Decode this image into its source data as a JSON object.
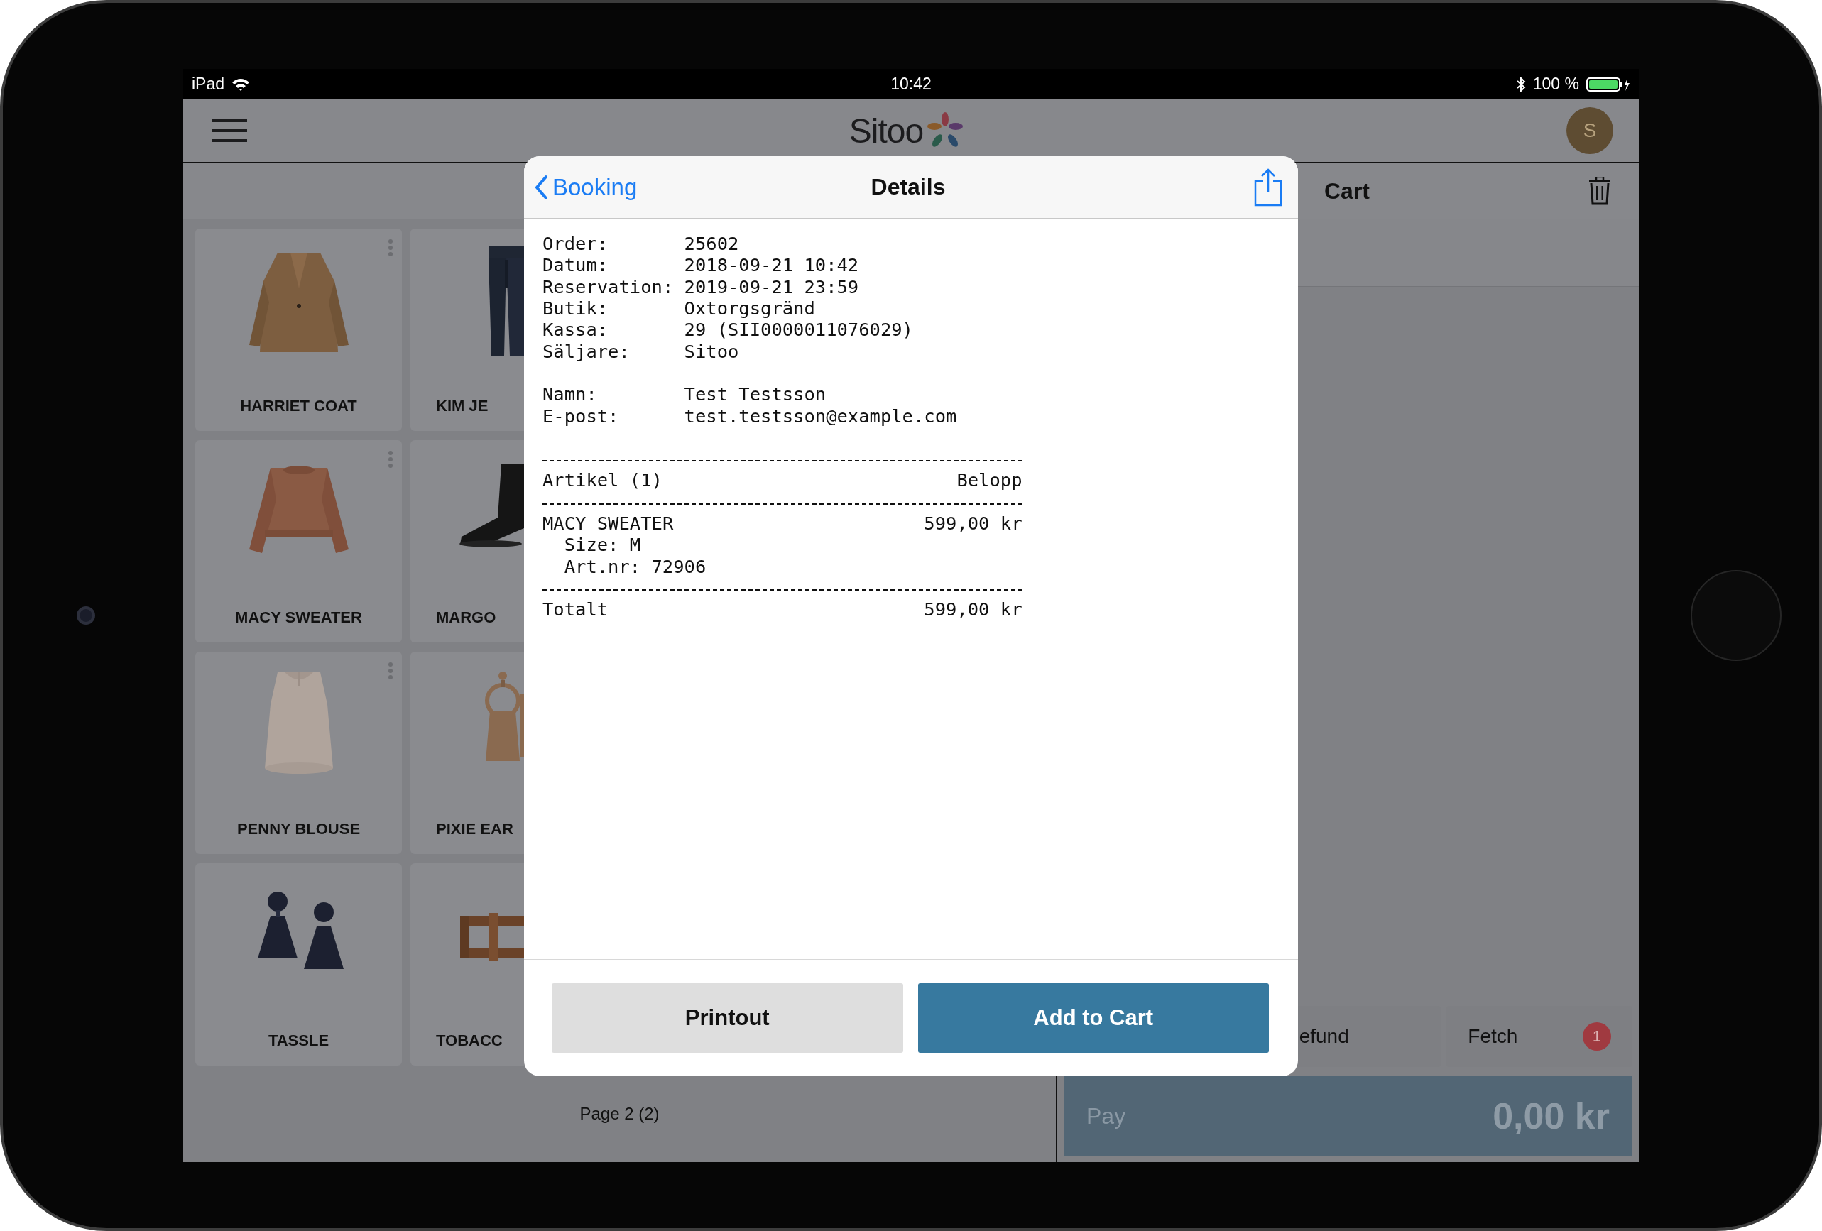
{
  "status_bar": {
    "device": "iPad",
    "time": "10:42",
    "battery": "100 %"
  },
  "header": {
    "logo": "Sitoo",
    "avatar": "S"
  },
  "products": [
    {
      "name": "HARRIET COAT",
      "menu": true
    },
    {
      "name": "KIM JE",
      "menu": false
    },
    {
      "name": "MACY SWEATER",
      "menu": true
    },
    {
      "name": "MARGO",
      "menu": false
    },
    {
      "name": "PENNY BLOUSE",
      "menu": true
    },
    {
      "name": "PIXIE EAR",
      "menu": false
    },
    {
      "name": "TASSLE",
      "menu": false
    },
    {
      "name": "TOBACC",
      "menu": false
    }
  ],
  "pager": "Page 2 (2)",
  "cart": {
    "title": "Cart",
    "buttons": [
      {
        "label": "efund",
        "kind": "plain"
      },
      {
        "label": "Fetch",
        "kind": "badge",
        "badge": "1"
      }
    ],
    "pay": {
      "label": "Pay",
      "amount": "0,00 kr"
    }
  },
  "dialog": {
    "back": "Booking",
    "title": "Details",
    "receipt": [
      {
        "kind": "field",
        "label": "Order:",
        "value": "25602"
      },
      {
        "kind": "field",
        "label": "Datum:",
        "value": "2018-09-21 10:42"
      },
      {
        "kind": "field",
        "label": "Reservation:",
        "value": "2019-09-21 23:59"
      },
      {
        "kind": "field",
        "label": "Butik:",
        "value": "Oxtorgsgränd"
      },
      {
        "kind": "field",
        "label": "Kassa:",
        "value": "29 (SII0000011076029)"
      },
      {
        "kind": "field",
        "label": "Säljare:",
        "value": "Sitoo"
      },
      {
        "kind": "blank"
      },
      {
        "kind": "field",
        "label": "Namn:",
        "value": "Test Testsson"
      },
      {
        "kind": "field",
        "label": "E-post:",
        "value": "test.testsson@example.com"
      },
      {
        "kind": "blank"
      },
      {
        "kind": "rule"
      },
      {
        "kind": "row",
        "left": "Artikel (1)",
        "right": "Belopp"
      },
      {
        "kind": "rule"
      },
      {
        "kind": "row",
        "left": "MACY SWEATER",
        "right": "599,00 kr"
      },
      {
        "kind": "indent",
        "text": "Size: M"
      },
      {
        "kind": "indent",
        "text": "Art.nr: 72906"
      },
      {
        "kind": "rule"
      },
      {
        "kind": "row",
        "left": "Totalt",
        "right": "599,00 kr"
      }
    ],
    "buttons": [
      {
        "label": "Printout",
        "kind": "secondary"
      },
      {
        "label": "Add to Cart",
        "kind": "primary"
      }
    ]
  }
}
